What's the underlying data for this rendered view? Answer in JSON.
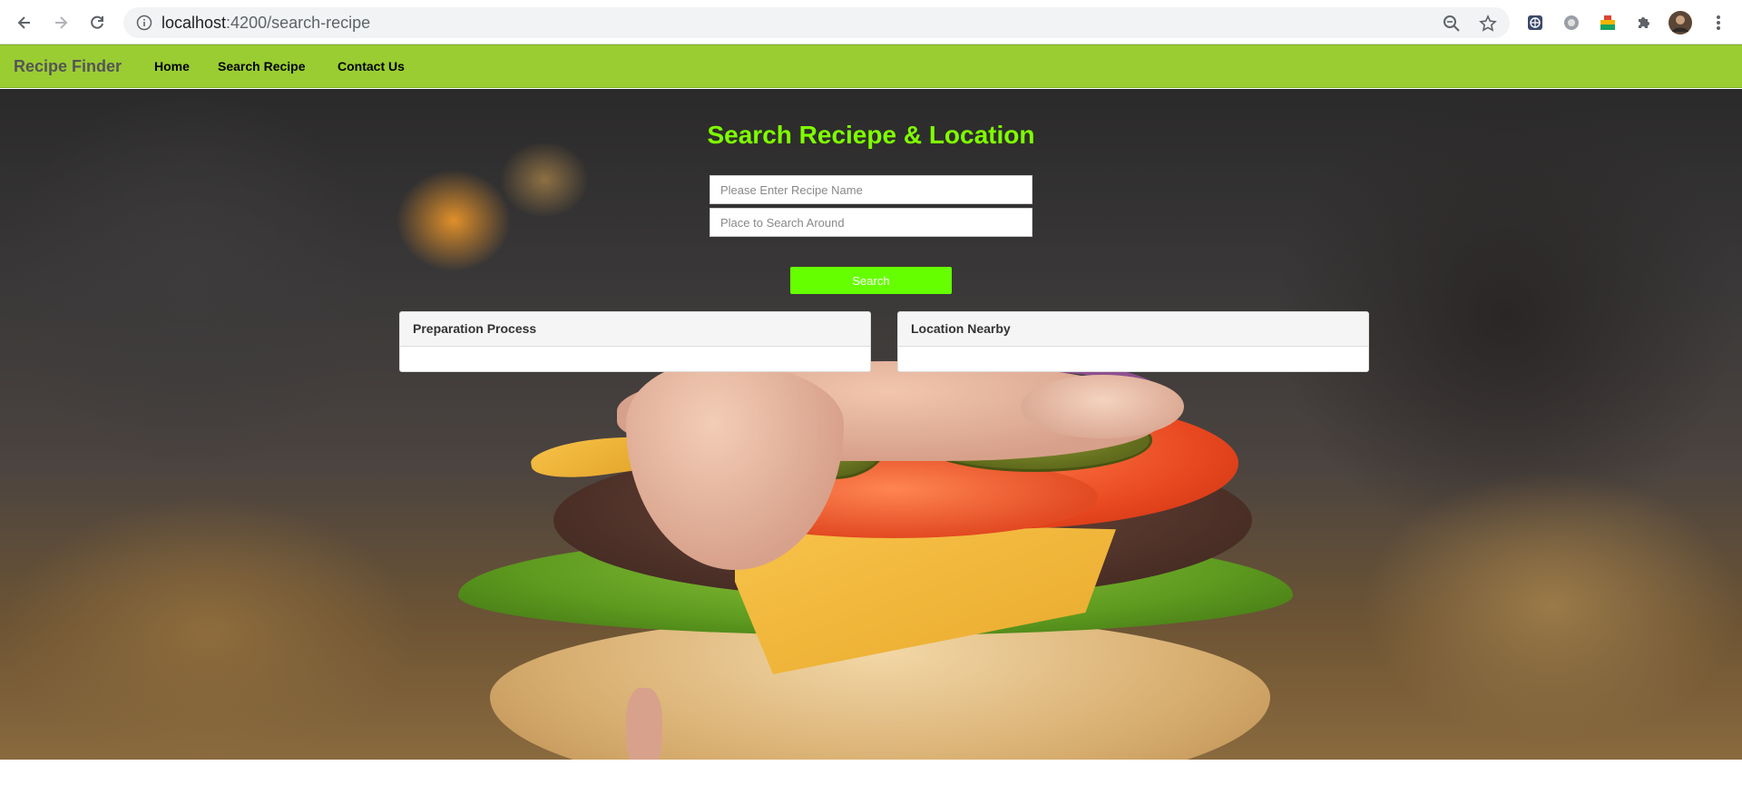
{
  "browser": {
    "url_host": "localhost",
    "url_path": ":4200/search-recipe"
  },
  "navbar": {
    "brand": "Recipe Finder",
    "links": [
      "Home",
      "Search Recipe",
      "Contact Us"
    ]
  },
  "main": {
    "title": "Search Reciepe & Location",
    "recipe_input": {
      "placeholder": "Please Enter Recipe Name",
      "value": ""
    },
    "place_input": {
      "placeholder": "Place to Search Around",
      "value": ""
    },
    "search_button": "Search",
    "panels": [
      {
        "heading": "Preparation Process",
        "body": ""
      },
      {
        "heading": "Location Nearby",
        "body": ""
      }
    ]
  },
  "colors": {
    "navbar": "#9acd32",
    "title": "#7fff00",
    "search_button": "#66ff00"
  }
}
